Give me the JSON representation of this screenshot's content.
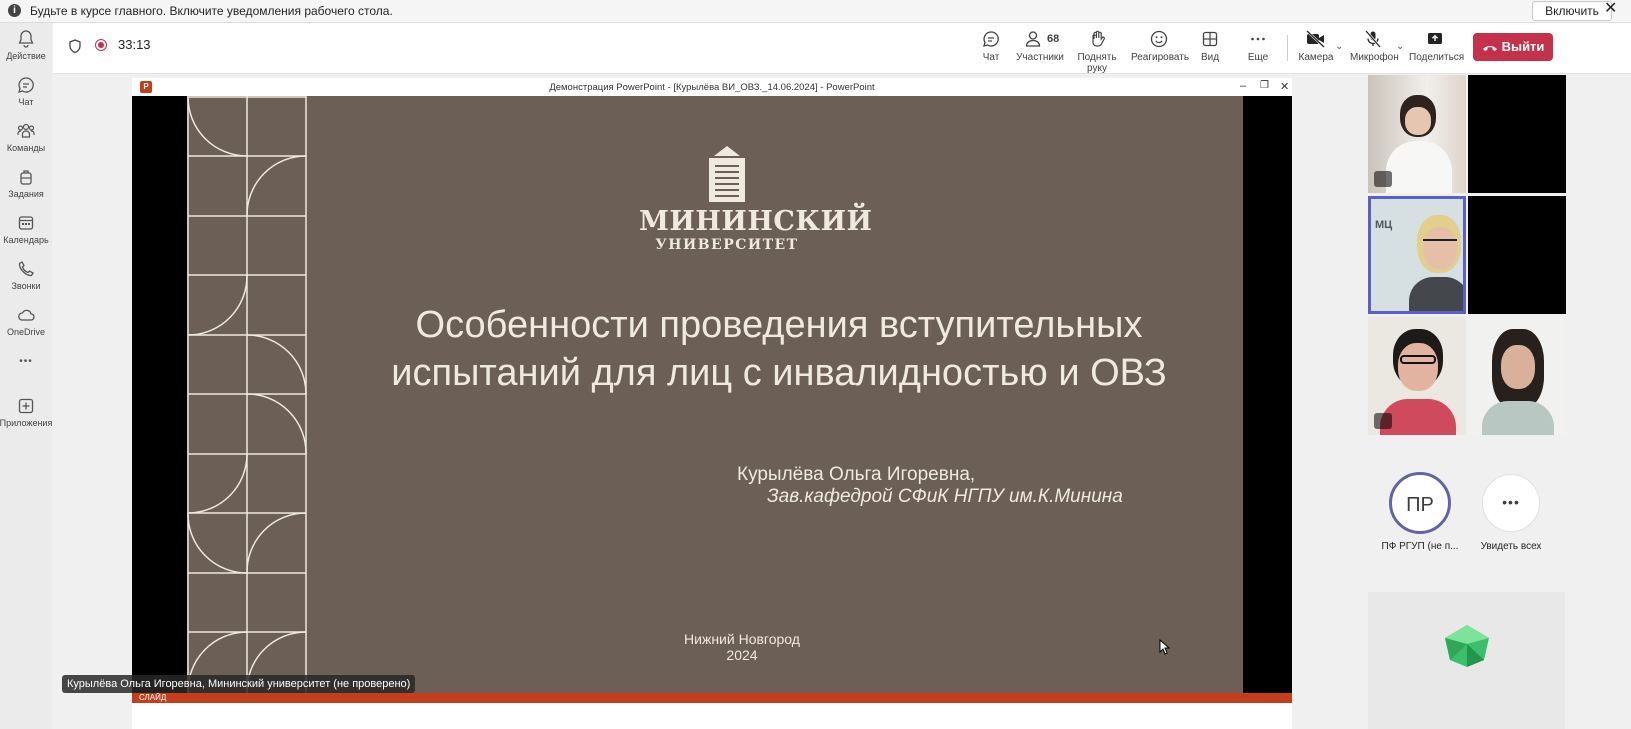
{
  "notification": {
    "message": "Будьте в курсе главного. Включите уведомления рабочего стола.",
    "enable_label": "Включить",
    "close_glyph": "✕"
  },
  "rail": {
    "items": [
      {
        "label": "Действие",
        "icon": "bell-icon"
      },
      {
        "label": "Чат",
        "icon": "chat-icon"
      },
      {
        "label": "Команды",
        "icon": "teams-icon"
      },
      {
        "label": "Задания",
        "icon": "backpack-icon"
      },
      {
        "label": "Календарь",
        "icon": "calendar-icon"
      },
      {
        "label": "Звонки",
        "icon": "phone-icon"
      },
      {
        "label": "OneDrive",
        "icon": "cloud-icon"
      },
      {
        "label": "Приложения",
        "icon": "plus-icon"
      }
    ],
    "more_glyph": "•••"
  },
  "toolbar": {
    "timer": "33:13",
    "chat": "Чат",
    "participants": "Участники",
    "participants_count": "68",
    "raise_hand": "Поднять руку",
    "react": "Реагировать",
    "view": "Вид",
    "more": "Еще",
    "camera": "Камера",
    "mic": "Микрофон",
    "share": "Поделиться",
    "leave": "Выйти"
  },
  "powerpoint": {
    "window_title": "Демонстрация PowerPoint - [Курылёва ВИ_ОВЗ._14.06.2024] - PowerPoint",
    "logo_letter": "P",
    "status": "СЛАЙД"
  },
  "slide": {
    "logo_name": "МИНИНСКИЙ",
    "logo_sub": "УНИВЕРСИТЕТ",
    "title_line1": "Особенности проведения вступительных",
    "title_line2": "испытаний для лиц с инвалидностью и ОВЗ",
    "author": "Курылёва Ольга Игоревна,",
    "position": "Зав.кафедрой СФиК НГПУ им.К.Минина",
    "city": "Нижний Новгород",
    "year": "2024"
  },
  "speaker_label": "Курылёва Ольга Игоревна, Мининский университет (не проверено)",
  "participants": {
    "avatar_initials": "ПР",
    "avatar_name": "ПФ РГУП (не п...",
    "see_all": "Увидеть всех",
    "see_all_glyph": "•••",
    "tile_text": "МЦ"
  },
  "colors": {
    "slide_bg": "#6c5f55",
    "slide_text": "#efe9df",
    "leave_red": "#c4314b",
    "ppt_orange": "#c43e1c",
    "accent_purple": "#5b5fc7"
  }
}
